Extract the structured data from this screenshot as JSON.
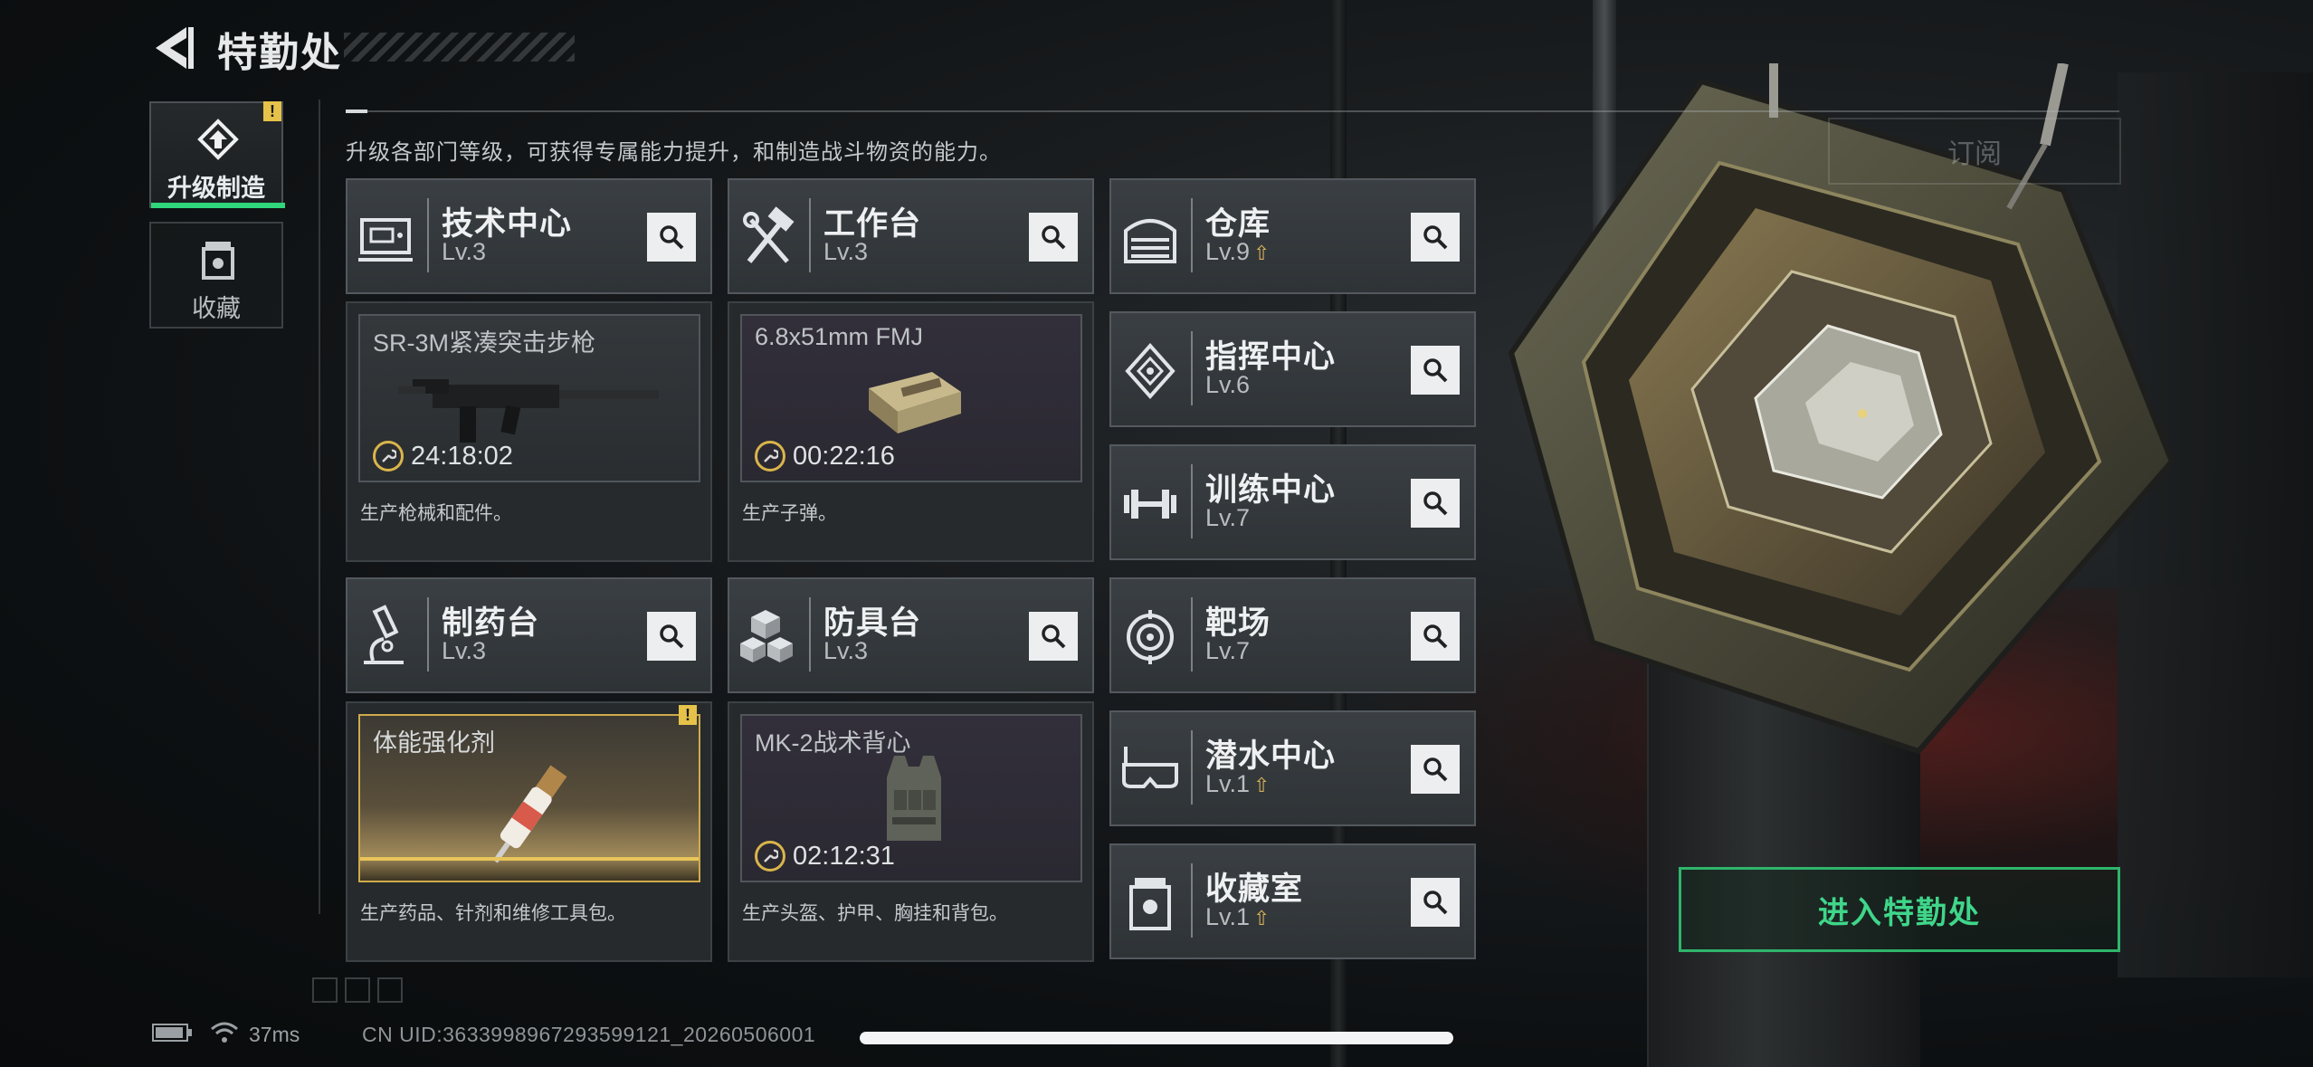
{
  "header": {
    "title": "特勤处",
    "subscribe_label": "订阅"
  },
  "nav": {
    "upgrade_label": "升级制造",
    "favorites_label": "收藏",
    "upgrade_badge": "!"
  },
  "intro": "升级各部门等级，可获得专属能力提升，和制造战斗物资的能力。",
  "departments": {
    "tech": {
      "name": "技术中心",
      "level": "Lv.3"
    },
    "workbench": {
      "name": "工作台",
      "level": "Lv.3"
    },
    "pharmacy": {
      "name": "制药台",
      "level": "Lv.3"
    },
    "armor": {
      "name": "防具台",
      "level": "Lv.3"
    },
    "warehouse": {
      "name": "仓库",
      "level": "Lv.9",
      "upgradable": true
    },
    "command": {
      "name": "指挥中心",
      "level": "Lv.6"
    },
    "training": {
      "name": "训练中心",
      "level": "Lv.7"
    },
    "range": {
      "name": "靶场",
      "level": "Lv.7"
    },
    "diving": {
      "name": "潜水中心",
      "level": "Lv.1",
      "upgradable": true
    },
    "collection": {
      "name": "收藏室",
      "level": "Lv.1",
      "upgradable": true
    }
  },
  "production": {
    "tech": {
      "item": "SR-3M紧凑突击步枪",
      "timer": "24:18:02",
      "desc": "生产枪械和配件。"
    },
    "workbench": {
      "item": "6.8x51mm FMJ",
      "timer": "00:22:16",
      "desc": "生产子弹。"
    },
    "pharmacy": {
      "item": "体能强化剂",
      "desc": "生产药品、针剂和维修工具包。",
      "badge": "!"
    },
    "armor": {
      "item": "MK-2战术背心",
      "timer": "02:12:31",
      "desc": "生产头盔、护甲、胸挂和背包。"
    }
  },
  "enter_button": "进入特勤处",
  "footer": {
    "ping": "37ms",
    "uid": "CN UID:3633998967293599121_20260506001"
  },
  "colors": {
    "accent_green": "#2fd67b",
    "warning_yellow": "#e6c24a",
    "timer_gold": "#d9b54b"
  }
}
